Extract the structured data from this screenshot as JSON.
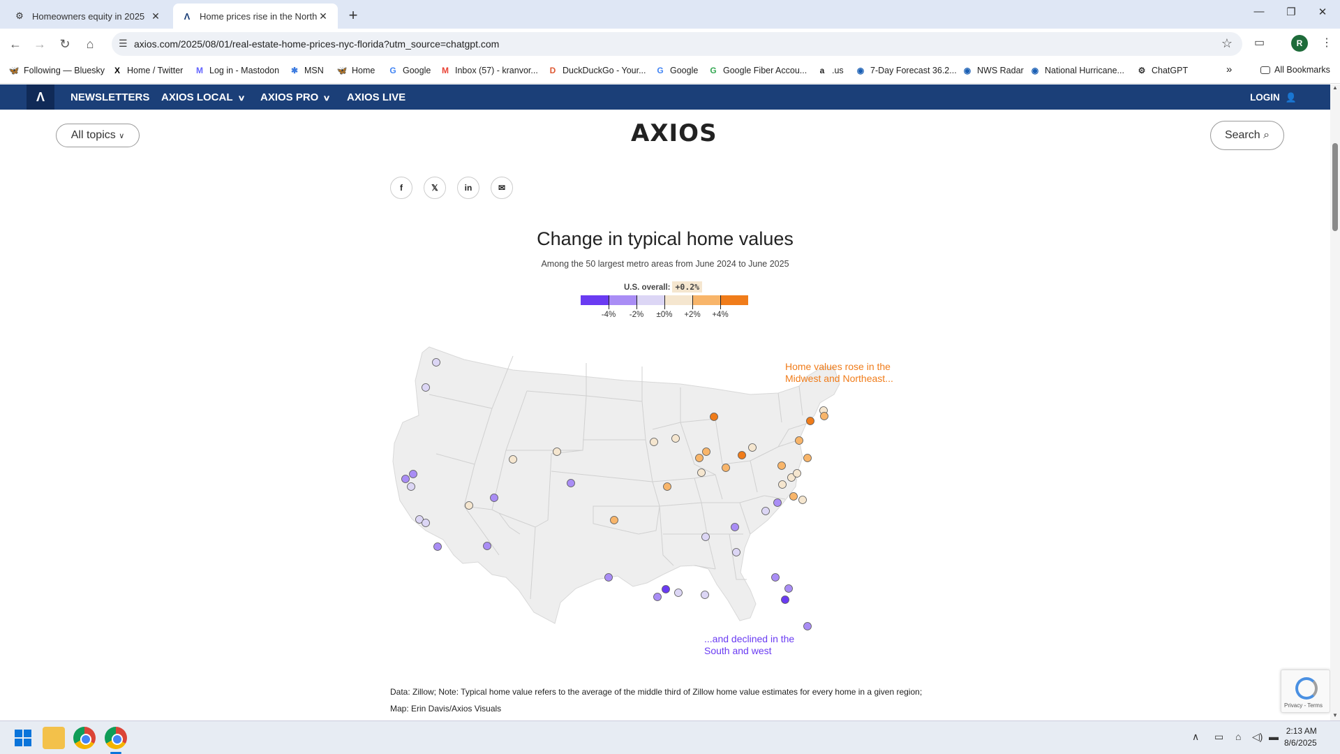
{
  "browser": {
    "tabs": [
      {
        "title": "Homeowners equity in 2025",
        "favicon": "chatgpt-icon"
      },
      {
        "title": "Home prices rise in the North a",
        "favicon": "axios-icon"
      }
    ],
    "url": "axios.com/2025/08/01/real-estate-home-prices-nyc-florida?utm_source=chatgpt.com",
    "profile_initial": "R",
    "bookmarks": [
      {
        "label": "Following — Bluesky",
        "icon": "bluesky-icon",
        "color": "#1185fe"
      },
      {
        "label": "Home / Twitter",
        "icon": "x-icon",
        "color": "#000000"
      },
      {
        "label": "Log in - Mastodon",
        "icon": "mastodon-icon",
        "color": "#6364ff"
      },
      {
        "label": "MSN",
        "icon": "msn-icon",
        "color": "#3c7be0"
      },
      {
        "label": "Home",
        "icon": "bluesky-icon",
        "color": "#1185fe"
      },
      {
        "label": "Google",
        "icon": "google-icon",
        "color": "#4285f4"
      },
      {
        "label": "Inbox (57) - kranvor...",
        "icon": "gmail-icon",
        "color": "#ea4335"
      },
      {
        "label": "DuckDuckGo - Your...",
        "icon": "duckduckgo-icon",
        "color": "#de5833"
      },
      {
        "label": "Google",
        "icon": "google-icon",
        "color": "#4285f4"
      },
      {
        "label": "Google Fiber Accou...",
        "icon": "google-fiber-icon",
        "color": "#34a853"
      },
      {
        "label": ".us",
        "icon": "amazon-icon",
        "color": "#222222"
      },
      {
        "label": "7-Day Forecast 36.2...",
        "icon": "nws-icon",
        "color": "#1a5fb4"
      },
      {
        "label": "NWS Radar",
        "icon": "nws-icon",
        "color": "#1a5fb4"
      },
      {
        "label": "National Hurricane...",
        "icon": "nhc-icon",
        "color": "#1a5fb4"
      },
      {
        "label": "ChatGPT",
        "icon": "chatgpt-icon",
        "color": "#333333"
      }
    ],
    "all_bookmarks_label": "All Bookmarks"
  },
  "site": {
    "nav": {
      "newsletters": "NEWSLETTERS",
      "axios_local": "AXIOS LOCAL",
      "axios_pro": "AXIOS PRO",
      "axios_live": "AXIOS LIVE",
      "login": "LOGIN"
    },
    "all_topics": "All topics",
    "logo": "AXIOS",
    "search": "Search",
    "share_buttons": [
      "f",
      "𝕏",
      "in",
      "✉"
    ]
  },
  "chart": {
    "title": "Change in typical home values",
    "subtitle": "Among the 50 largest metro areas from June 2024 to June 2025",
    "us_overall_label": "U.S. overall:",
    "us_overall_value": "+0.2%",
    "legend_colors": [
      "#6a3bf2",
      "#a98df5",
      "#dcd6f5",
      "#f5e6cf",
      "#f8b56a",
      "#f07c1a"
    ],
    "legend_labels": [
      "-4%",
      "-2%",
      "±0%",
      "+2%",
      "+4%"
    ],
    "annotation_top": [
      "Home values rose in the",
      "Midwest and Northeast..."
    ],
    "annotation_bottom": [
      "...and declined in the",
      "South and west"
    ],
    "source": "Data: Zillow; Note: Typical home value refers to the average of the middle third of Zillow home value estimates for every home in a given region;",
    "credit": "Map: Erin Davis/Axios Visuals"
  },
  "recaptcha_text": "Privacy - Terms",
  "clock": {
    "time": "2:13 AM",
    "date": "8/6/2025"
  }
}
